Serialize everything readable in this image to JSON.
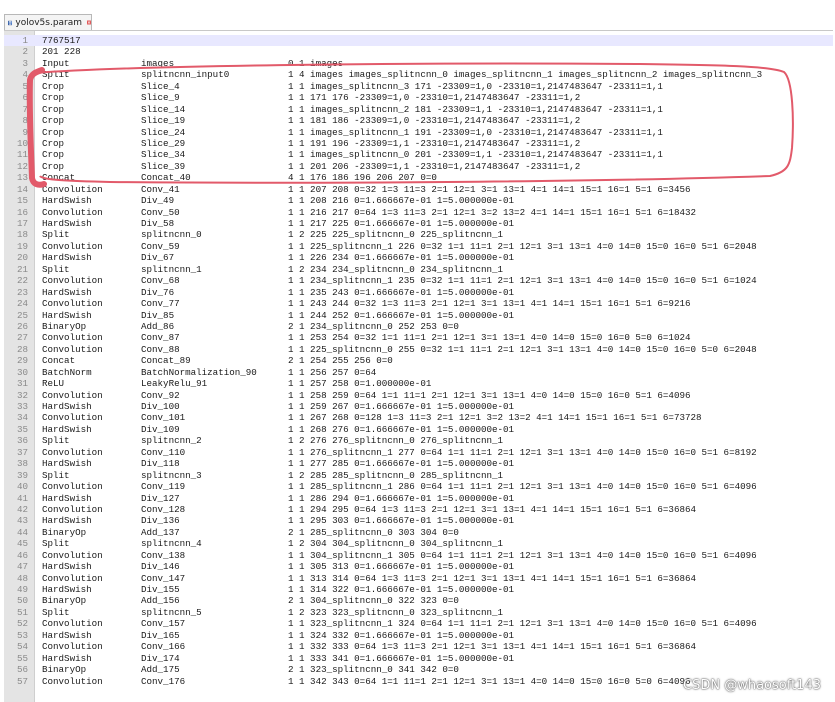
{
  "tab": {
    "title": "yolov5s.param",
    "icons": [
      "save-disk-icon",
      "close-icon"
    ]
  },
  "rows": [
    {
      "n": "1",
      "text": "7767517"
    },
    {
      "n": "2",
      "text": "201 228"
    },
    {
      "n": "3",
      "type": "Input",
      "name": "images",
      "params": "0 1 images"
    },
    {
      "n": "4",
      "type": "Split",
      "name": "splitncnn_input0",
      "params": "1 4 images images_splitncnn_0 images_splitncnn_1 images_splitncnn_2 images_splitncnn_3"
    },
    {
      "n": "5",
      "type": "Crop",
      "name": "Slice_4",
      "params": "1 1 images_splitncnn_3 171 -23309=1,0 -23310=1,2147483647 -23311=1,1"
    },
    {
      "n": "6",
      "type": "Crop",
      "name": "Slice_9",
      "params": "1 1 171 176 -23309=1,0 -23310=1,2147483647 -23311=1,2"
    },
    {
      "n": "7",
      "type": "Crop",
      "name": "Slice_14",
      "params": "1 1 images_splitncnn_2 181 -23309=1,1 -23310=1,2147483647 -23311=1,1"
    },
    {
      "n": "8",
      "type": "Crop",
      "name": "Slice_19",
      "params": "1 1 181 186 -23309=1,0 -23310=1,2147483647 -23311=1,2"
    },
    {
      "n": "9",
      "type": "Crop",
      "name": "Slice_24",
      "params": "1 1 images_splitncnn_1 191 -23309=1,0 -23310=1,2147483647 -23311=1,1"
    },
    {
      "n": "10",
      "type": "Crop",
      "name": "Slice_29",
      "params": "1 1 191 196 -23309=1,1 -23310=1,2147483647 -23311=1,2"
    },
    {
      "n": "11",
      "type": "Crop",
      "name": "Slice_34",
      "params": "1 1 images_splitncnn_0 201 -23309=1,1 -23310=1,2147483647 -23311=1,1"
    },
    {
      "n": "12",
      "type": "Crop",
      "name": "Slice_39",
      "params": "1 1 201 206 -23309=1,1 -23310=1,2147483647 -23311=1,2"
    },
    {
      "n": "13",
      "type": "Concat",
      "name": "Concat_40",
      "params": "4 1 176 186 196 206 207 0=0"
    },
    {
      "n": "14",
      "type": "Convolution",
      "name": "Conv_41",
      "params": "1 1 207 208 0=32 1=3 11=3 2=1 12=1 3=1 13=1 4=1 14=1 15=1 16=1 5=1 6=3456"
    },
    {
      "n": "15",
      "type": "HardSwish",
      "name": "Div_49",
      "params": "1 1 208 216 0=1.666667e-01 1=5.000000e-01"
    },
    {
      "n": "16",
      "type": "Convolution",
      "name": "Conv_50",
      "params": "1 1 216 217 0=64 1=3 11=3 2=1 12=1 3=2 13=2 4=1 14=1 15=1 16=1 5=1 6=18432"
    },
    {
      "n": "17",
      "type": "HardSwish",
      "name": "Div_58",
      "params": "1 1 217 225 0=1.666667e-01 1=5.000000e-01"
    },
    {
      "n": "18",
      "type": "Split",
      "name": "splitncnn_0",
      "params": "1 2 225 225_splitncnn_0 225_splitncnn_1"
    },
    {
      "n": "19",
      "type": "Convolution",
      "name": "Conv_59",
      "params": "1 1 225_splitncnn_1 226 0=32 1=1 11=1 2=1 12=1 3=1 13=1 4=0 14=0 15=0 16=0 5=1 6=2048"
    },
    {
      "n": "20",
      "type": "HardSwish",
      "name": "Div_67",
      "params": "1 1 226 234 0=1.666667e-01 1=5.000000e-01"
    },
    {
      "n": "21",
      "type": "Split",
      "name": "splitncnn_1",
      "params": "1 2 234 234_splitncnn_0 234_splitncnn_1"
    },
    {
      "n": "22",
      "type": "Convolution",
      "name": "Conv_68",
      "params": "1 1 234_splitncnn_1 235 0=32 1=1 11=1 2=1 12=1 3=1 13=1 4=0 14=0 15=0 16=0 5=1 6=1024"
    },
    {
      "n": "23",
      "type": "HardSwish",
      "name": "Div_76",
      "params": "1 1 235 243 0=1.666667e-01 1=5.000000e-01"
    },
    {
      "n": "24",
      "type": "Convolution",
      "name": "Conv_77",
      "params": "1 1 243 244 0=32 1=3 11=3 2=1 12=1 3=1 13=1 4=1 14=1 15=1 16=1 5=1 6=9216"
    },
    {
      "n": "25",
      "type": "HardSwish",
      "name": "Div_85",
      "params": "1 1 244 252 0=1.666667e-01 1=5.000000e-01"
    },
    {
      "n": "26",
      "type": "BinaryOp",
      "name": "Add_86",
      "params": "2 1 234_splitncnn_0 252 253 0=0"
    },
    {
      "n": "27",
      "type": "Convolution",
      "name": "Conv_87",
      "params": "1 1 253 254 0=32 1=1 11=1 2=1 12=1 3=1 13=1 4=0 14=0 15=0 16=0 5=0 6=1024"
    },
    {
      "n": "28",
      "type": "Convolution",
      "name": "Conv_88",
      "params": "1 1 225_splitncnn_0 255 0=32 1=1 11=1 2=1 12=1 3=1 13=1 4=0 14=0 15=0 16=0 5=0 6=2048"
    },
    {
      "n": "29",
      "type": "Concat",
      "name": "Concat_89",
      "params": "2 1 254 255 256 0=0"
    },
    {
      "n": "30",
      "type": "BatchNorm",
      "name": "BatchNormalization_90",
      "params": "1 1 256 257 0=64"
    },
    {
      "n": "31",
      "type": "ReLU",
      "name": "LeakyRelu_91",
      "params": "1 1 257 258 0=1.000000e-01"
    },
    {
      "n": "32",
      "type": "Convolution",
      "name": "Conv_92",
      "params": "1 1 258 259 0=64 1=1 11=1 2=1 12=1 3=1 13=1 4=0 14=0 15=0 16=0 5=1 6=4096"
    },
    {
      "n": "33",
      "type": "HardSwish",
      "name": "Div_100",
      "params": "1 1 259 267 0=1.666667e-01 1=5.000000e-01"
    },
    {
      "n": "34",
      "type": "Convolution",
      "name": "Conv_101",
      "params": "1 1 267 268 0=128 1=3 11=3 2=1 12=1 3=2 13=2 4=1 14=1 15=1 16=1 5=1 6=73728"
    },
    {
      "n": "35",
      "type": "HardSwish",
      "name": "Div_109",
      "params": "1 1 268 276 0=1.666667e-01 1=5.000000e-01"
    },
    {
      "n": "36",
      "type": "Split",
      "name": "splitncnn_2",
      "params": "1 2 276 276_splitncnn_0 276_splitncnn_1"
    },
    {
      "n": "37",
      "type": "Convolution",
      "name": "Conv_110",
      "params": "1 1 276_splitncnn_1 277 0=64 1=1 11=1 2=1 12=1 3=1 13=1 4=0 14=0 15=0 16=0 5=1 6=8192"
    },
    {
      "n": "38",
      "type": "HardSwish",
      "name": "Div_118",
      "params": "1 1 277 285 0=1.666667e-01 1=5.000000e-01"
    },
    {
      "n": "39",
      "type": "Split",
      "name": "splitncnn_3",
      "params": "1 2 285 285_splitncnn_0 285_splitncnn_1"
    },
    {
      "n": "40",
      "type": "Convolution",
      "name": "Conv_119",
      "params": "1 1 285_splitncnn_1 286 0=64 1=1 11=1 2=1 12=1 3=1 13=1 4=0 14=0 15=0 16=0 5=1 6=4096"
    },
    {
      "n": "41",
      "type": "HardSwish",
      "name": "Div_127",
      "params": "1 1 286 294 0=1.666667e-01 1=5.000000e-01"
    },
    {
      "n": "42",
      "type": "Convolution",
      "name": "Conv_128",
      "params": "1 1 294 295 0=64 1=3 11=3 2=1 12=1 3=1 13=1 4=1 14=1 15=1 16=1 5=1 6=36864"
    },
    {
      "n": "43",
      "type": "HardSwish",
      "name": "Div_136",
      "params": "1 1 295 303 0=1.666667e-01 1=5.000000e-01"
    },
    {
      "n": "44",
      "type": "BinaryOp",
      "name": "Add_137",
      "params": "2 1 285_splitncnn_0 303 304 0=0"
    },
    {
      "n": "45",
      "type": "Split",
      "name": "splitncnn_4",
      "params": "1 2 304 304_splitncnn_0 304_splitncnn_1"
    },
    {
      "n": "46",
      "type": "Convolution",
      "name": "Conv_138",
      "params": "1 1 304_splitncnn_1 305 0=64 1=1 11=1 2=1 12=1 3=1 13=1 4=0 14=0 15=0 16=0 5=1 6=4096"
    },
    {
      "n": "47",
      "type": "HardSwish",
      "name": "Div_146",
      "params": "1 1 305 313 0=1.666667e-01 1=5.000000e-01"
    },
    {
      "n": "48",
      "type": "Convolution",
      "name": "Conv_147",
      "params": "1 1 313 314 0=64 1=3 11=3 2=1 12=1 3=1 13=1 4=1 14=1 15=1 16=1 5=1 6=36864"
    },
    {
      "n": "49",
      "type": "HardSwish",
      "name": "Div_155",
      "params": "1 1 314 322 0=1.666667e-01 1=5.000000e-01"
    },
    {
      "n": "50",
      "type": "BinaryOp",
      "name": "Add_156",
      "params": "2 1 304_splitncnn_0 322 323 0=0"
    },
    {
      "n": "51",
      "type": "Split",
      "name": "splitncnn_5",
      "params": "1 2 323 323_splitncnn_0 323_splitncnn_1"
    },
    {
      "n": "52",
      "type": "Convolution",
      "name": "Conv_157",
      "params": "1 1 323_splitncnn_1 324 0=64 1=1 11=1 2=1 12=1 3=1 13=1 4=0 14=0 15=0 16=0 5=1 6=4096"
    },
    {
      "n": "53",
      "type": "HardSwish",
      "name": "Div_165",
      "params": "1 1 324 332 0=1.666667e-01 1=5.000000e-01"
    },
    {
      "n": "54",
      "type": "Convolution",
      "name": "Conv_166",
      "params": "1 1 332 333 0=64 1=3 11=3 2=1 12=1 3=1 13=1 4=1 14=1 15=1 16=1 5=1 6=36864"
    },
    {
      "n": "55",
      "type": "HardSwish",
      "name": "Div_174",
      "params": "1 1 333 341 0=1.666667e-01 1=5.000000e-01"
    },
    {
      "n": "56",
      "type": "BinaryOp",
      "name": "Add_175",
      "params": "2 1 323_splitncnn_0 341 342 0=0"
    },
    {
      "n": "57",
      "type": "Convolution",
      "name": "Conv_176",
      "params": "1 1 342 343 0=64 1=1 11=1 2=1 12=1 3=1 13=1 4=0 14=0 15=0 16=0 5=0 6=4096"
    }
  ],
  "annotation": {
    "color": "#e25a6a"
  },
  "watermark": "CSDN @whaosoft143"
}
